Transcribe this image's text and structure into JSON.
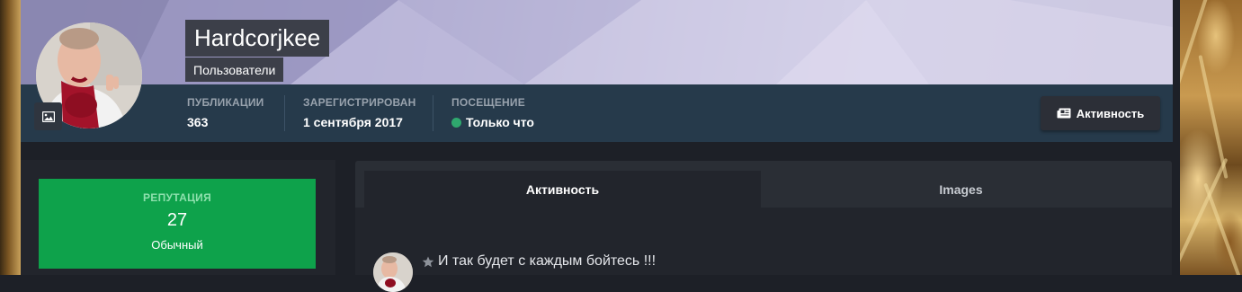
{
  "profile": {
    "username": "Hardcorjkee",
    "group": "Пользователи"
  },
  "stats": [
    {
      "label": "ПУБЛИКАЦИИ",
      "value": "363"
    },
    {
      "label": "ЗАРЕГИСТРИРОВАН",
      "value": "1 сентября 2017"
    },
    {
      "label": "ПОСЕЩЕНИЕ",
      "value": "Только что"
    }
  ],
  "actions": {
    "activity_label": "Активность"
  },
  "reputation": {
    "title": "РЕПУТАЦИЯ",
    "value": "27",
    "level": "Обычный"
  },
  "tabs": [
    {
      "label": "Активность",
      "active": true
    },
    {
      "label": "Images",
      "active": false
    }
  ],
  "feed": {
    "first_item_title": "И так будет с каждым бойтесь !!!"
  },
  "icons": {
    "avatar_edit": "image-icon",
    "activity_button": "newspaper-icon",
    "online_status": "online-dot-icon",
    "feed_item": "star-icon"
  },
  "colors": {
    "stats_bar": "#263a4b",
    "reputation_bg": "#0ea24b",
    "online": "#2fa86e"
  }
}
